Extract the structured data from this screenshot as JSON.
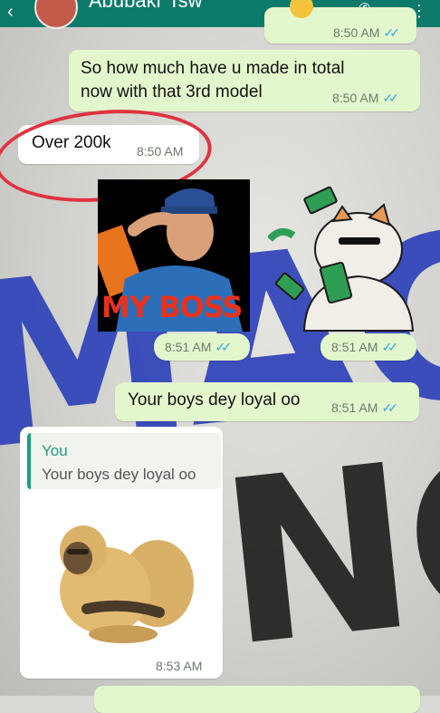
{
  "header": {
    "contact_name": "Abubakr Tsw"
  },
  "messages": [
    {
      "text": "",
      "time": "8:50 AM",
      "ticks": "✓✓"
    },
    {
      "text": "So how much have u made in total now with that 3rd model",
      "line1": "So how much have u made in total",
      "line2": "now with that 3rd model",
      "time": "8:50 AM",
      "ticks": "✓✓"
    },
    {
      "text": "Over 200k",
      "time": "8:50 AM"
    },
    {
      "sticker": "my-boss-sticker",
      "sticker_text": "MY BOSS",
      "time": "8:51 AM",
      "ticks": "✓✓"
    },
    {
      "sticker": "money-cat-sticker",
      "time": "8:51 AM",
      "ticks": "✓✓"
    },
    {
      "text": "Your boys dey loyal oo",
      "time": "8:51 AM",
      "ticks": "✓✓"
    },
    {
      "reply_to": {
        "author": "You",
        "text": "Your boys dey loyal oo"
      },
      "sticker": "monkey-sticker",
      "time": "8:53 AM"
    }
  ],
  "colors": {
    "header": "#0b7a6b",
    "outgoing": "#e3f7cc",
    "incoming": "#ffffff",
    "annotation": "#e0323f",
    "read_ticks": "#34a7e0"
  }
}
